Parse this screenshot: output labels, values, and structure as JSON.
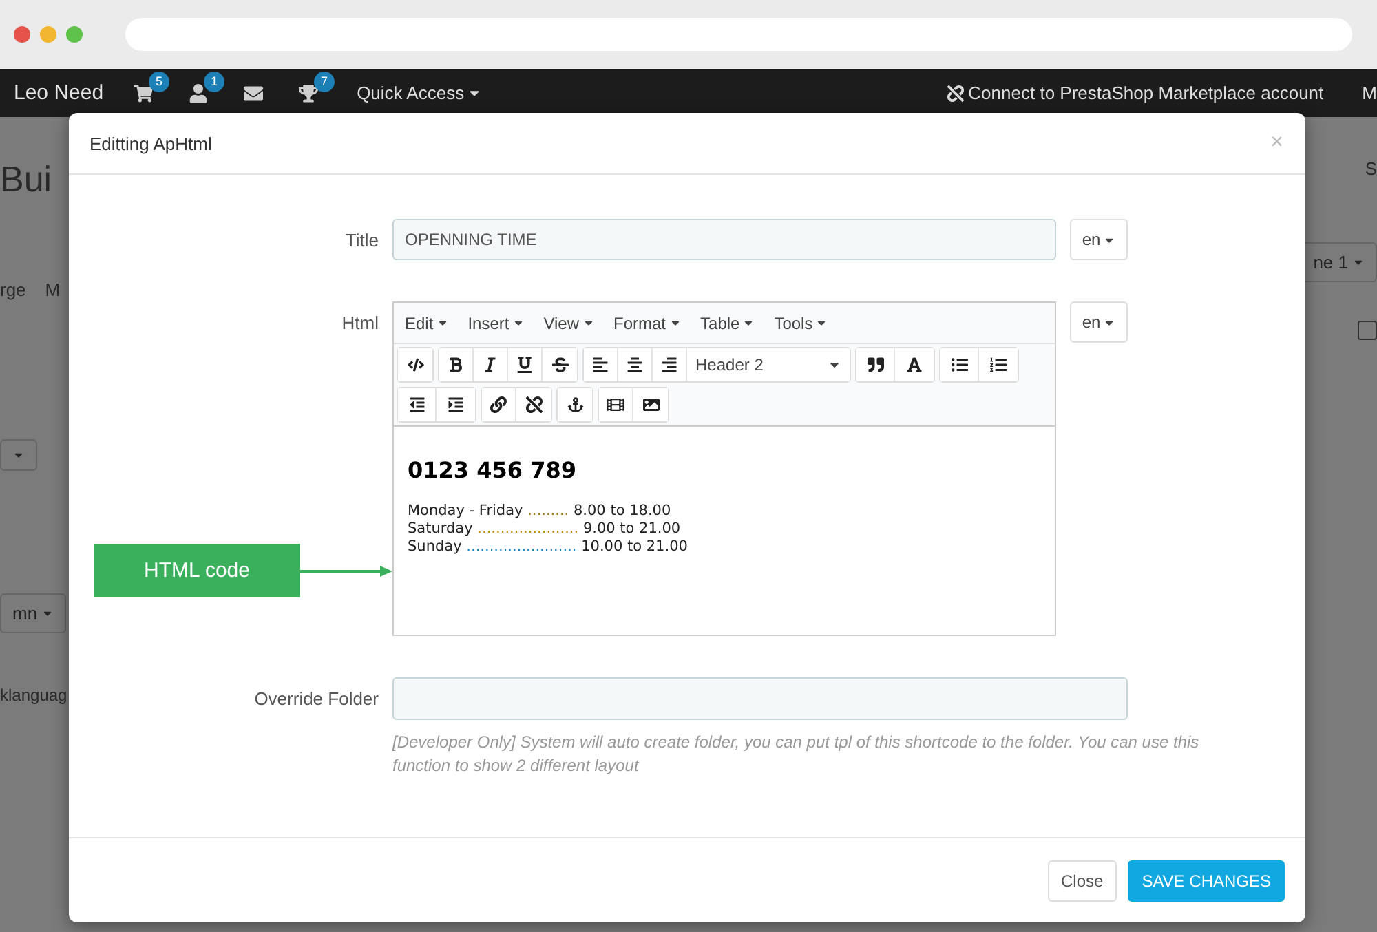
{
  "topbar": {
    "brand": "Leo Need",
    "icons": [
      {
        "kind": "cart",
        "badge": "5"
      },
      {
        "kind": "user",
        "badge": "1"
      },
      {
        "kind": "mail"
      },
      {
        "kind": "trophy",
        "badge": "7"
      }
    ],
    "quick_access": "Quick Access",
    "connect": "Connect to PrestaShop Marketplace account",
    "cut_item": "M"
  },
  "background": {
    "left": [
      {
        "kind": "title",
        "text": "Bui"
      },
      {
        "kind": "tabs",
        "text": "rge",
        "extra": "M"
      },
      {
        "kind": "dropdown"
      },
      {
        "kind": "dropdown",
        "text": "mn"
      },
      {
        "kind": "row",
        "text": "klanguag"
      }
    ],
    "right": [
      {
        "kind": "link",
        "text": "S"
      },
      {
        "kind": "dropdown",
        "text": "ne 1"
      },
      {
        "kind": "check",
        "checked": false
      }
    ]
  },
  "modal": {
    "title": "Editting ApHtml",
    "close": "×",
    "title_field": {
      "label": "Title",
      "value": "OPENNING TIME",
      "lang": "en"
    },
    "html_field": {
      "label": "Html",
      "lang": "en",
      "menus": [
        "Edit",
        "Insert",
        "View",
        "Format",
        "Table",
        "Tools"
      ],
      "toolbar": [
        [
          [
            {
              "kind": "code"
            }
          ],
          [
            {
              "kind": "bold"
            },
            {
              "kind": "italic"
            },
            {
              "kind": "underline"
            },
            {
              "kind": "strike"
            }
          ],
          [
            {
              "kind": "align-left"
            },
            {
              "kind": "align-center"
            },
            {
              "kind": "align-right"
            },
            {
              "kind": "select",
              "text": "Header 2"
            }
          ],
          [
            {
              "kind": "quote"
            },
            {
              "kind": "font-color"
            }
          ],
          [
            {
              "kind": "list-ul"
            },
            {
              "kind": "list-ol"
            }
          ]
        ],
        [
          [
            {
              "kind": "outdent"
            },
            {
              "kind": "indent"
            }
          ],
          [
            {
              "kind": "link"
            },
            {
              "kind": "unlink"
            }
          ],
          [
            {
              "kind": "anchor"
            }
          ],
          [
            {
              "kind": "film"
            },
            {
              "kind": "image"
            }
          ]
        ]
      ],
      "content": {
        "heading": "0123 456 789",
        "lines": [
          {
            "label": "Monday - Friday",
            "dots": ".........",
            "time": "8.00 to 18.00",
            "color": "#9a7a10"
          },
          {
            "label": "Saturday",
            "dots": "......................",
            "time": "9.00 to 21.00",
            "color": "#c48a00"
          },
          {
            "label": "Sunday",
            "dots": "........................",
            "time": "10.00 to 21.00",
            "color": "#1e88c8"
          }
        ]
      }
    },
    "annotation": {
      "text": "HTML code"
    },
    "folder_field": {
      "label": "Override Folder",
      "hint": "[Developer Only] System will auto create folder, you can put tpl of this shortcode to the folder. You can use this function to show 2 different layout"
    },
    "buttons": [
      {
        "kind": "default",
        "text": "Close"
      },
      {
        "kind": "primary",
        "text": "SAVE CHANGES"
      }
    ]
  }
}
